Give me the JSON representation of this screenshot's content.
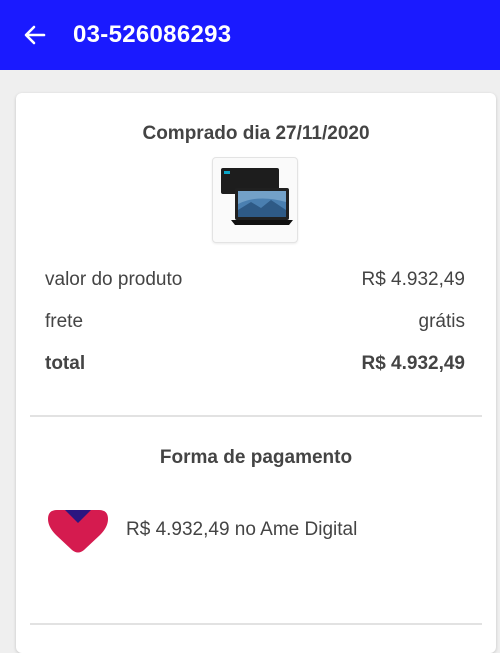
{
  "header": {
    "title": "03-526086293",
    "back_icon": "arrow-left-icon",
    "color": "#1a1aff"
  },
  "order": {
    "purchased_label": "Comprado dia 27/11/2020",
    "product_icon": "laptop-thumbnail",
    "rows": [
      {
        "label": "valor do produto",
        "value": "R$ 4.932,49"
      },
      {
        "label": "frete",
        "value": "grátis"
      },
      {
        "label": "total",
        "value": "R$ 4.932,49"
      }
    ]
  },
  "payment": {
    "title": "Forma de pagamento",
    "method_icon": "ame-digital-logo",
    "description": "R$ 4.932,49 no Ame Digital",
    "brand_colors": [
      "#d51b4f",
      "#2a1680"
    ]
  }
}
